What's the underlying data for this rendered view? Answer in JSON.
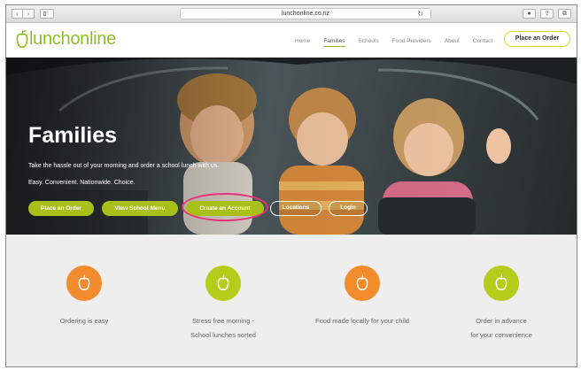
{
  "browser": {
    "url": "lunchonline.co.nz",
    "back_glyph": "‹",
    "forward_glyph": "›",
    "reload_glyph": "↻",
    "share_glyph": "⇪",
    "tabs_glyph": "⧉",
    "info_glyph": "●"
  },
  "header": {
    "logo_text": "lunchonline",
    "nav": [
      "Home",
      "Families",
      "Schools",
      "Food Providers",
      "About",
      "Contact"
    ],
    "active_nav": "Families",
    "cta_label": "Place an Order"
  },
  "hero": {
    "title": "Families",
    "subtitle": "Take the hassle out of your morning and order a school lunch with us.",
    "tagline": "Easy. Convenient. Nationwide. Choice.",
    "buttons": {
      "place_order": "Place an Order",
      "view_menu": "View School Menu",
      "create_account": "Create an Account",
      "locations": "Locations",
      "login": "Login"
    }
  },
  "features": [
    {
      "label_1": "Ordering is easy",
      "label_2": "",
      "color": "#f28b2b"
    },
    {
      "label_1": "Stress free morning -",
      "label_2": "School lunches sorted",
      "color": "#b6cc1a"
    },
    {
      "label_1": "Food made locally for your child",
      "label_2": "",
      "color": "#f28b2b"
    },
    {
      "label_1": "Order in advance",
      "label_2": "for your convenience",
      "color": "#b6cc1a"
    }
  ],
  "colors": {
    "brand_green": "#8cbf26",
    "button_green": "#a9bf1a",
    "highlight": "#e8347a",
    "orange": "#f28b2b",
    "lime": "#b6cc1a"
  },
  "icons": {
    "feature_icon": "apple-icon"
  }
}
